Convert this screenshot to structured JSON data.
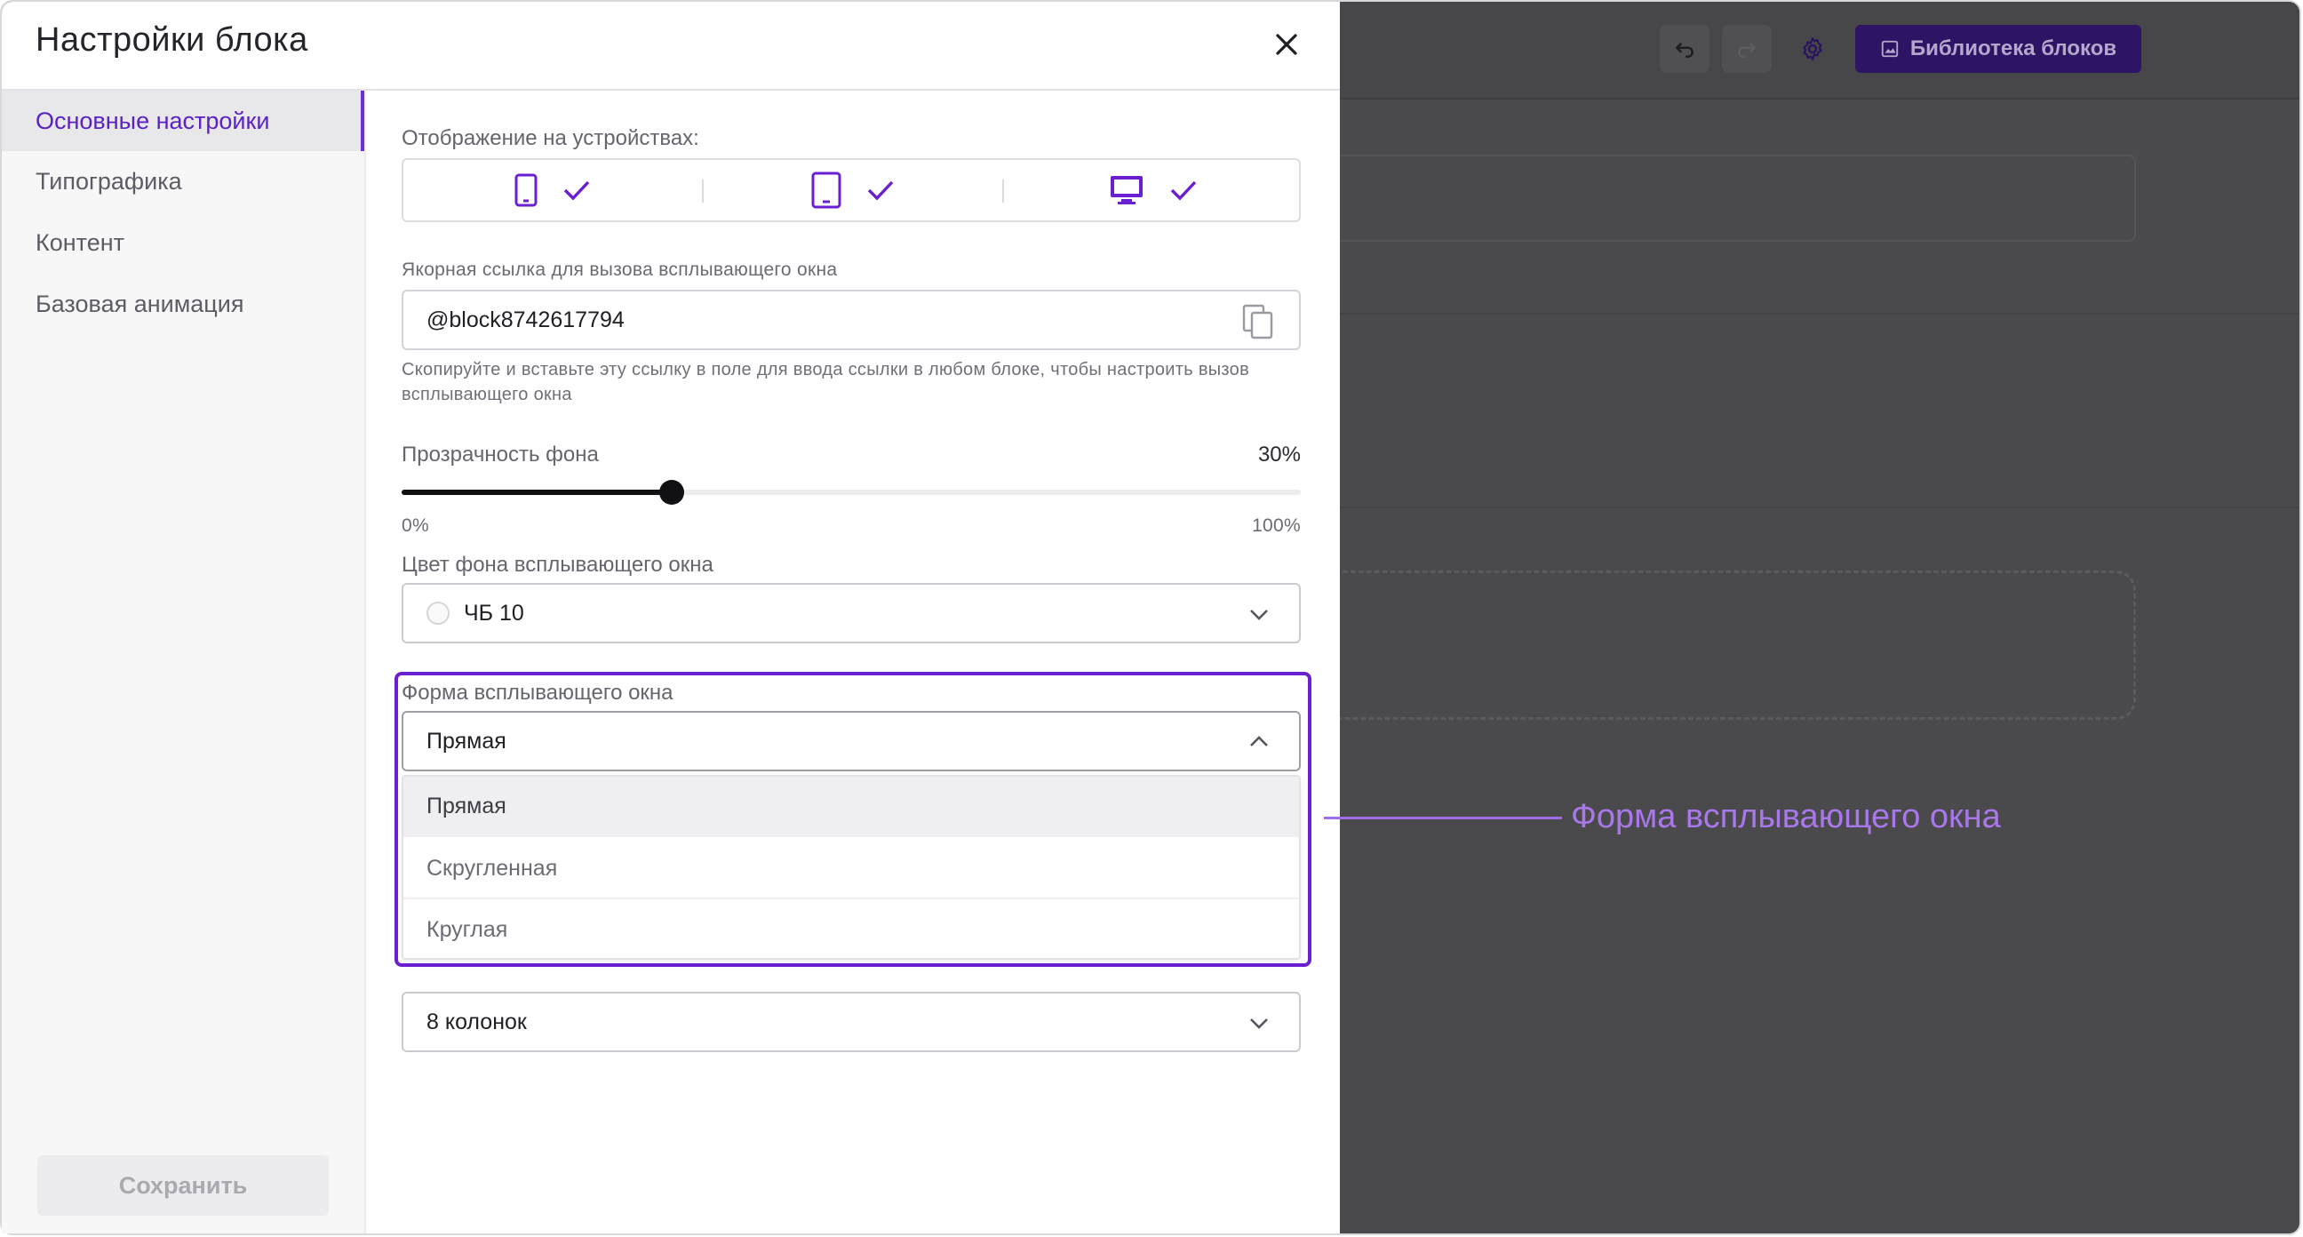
{
  "colors": {
    "accent": "#6a2fd6",
    "highlight_border": "#6a1fd1",
    "annotation": "#a877e9",
    "overlay": "#4a4a4d",
    "library_button_bg": "#2d1464"
  },
  "editor": {
    "toolbar": {
      "undo_icon": "undo-icon",
      "redo_icon": "redo-icon",
      "settings_icon": "gear-icon",
      "library_button_label": "Библиотека блоков",
      "library_button_icon": "image-icon"
    }
  },
  "modal": {
    "title": "Настройки блока",
    "close_icon": "close-icon",
    "sidebar": {
      "items": [
        {
          "label": "Основные настройки",
          "active": true
        },
        {
          "label": "Типографика",
          "active": false
        },
        {
          "label": "Контент",
          "active": false
        },
        {
          "label": "Базовая анимация",
          "active": false
        }
      ],
      "save_label": "Сохранить"
    },
    "devices": {
      "label": "Отображение на устройствах:",
      "items": [
        {
          "device": "mobile",
          "icon": "mobile-icon",
          "checked": true
        },
        {
          "device": "tablet",
          "icon": "tablet-icon",
          "checked": true
        },
        {
          "device": "desktop",
          "icon": "desktop-icon",
          "checked": true
        }
      ]
    },
    "anchor": {
      "label": "Якорная ссылка для вызова всплывающего окна",
      "value": "@block8742617794",
      "hint": "Скопируйте и вставьте эту ссылку в поле для ввода ссылки в любом блоке, чтобы настроить вызов всплывающего окна"
    },
    "opacity": {
      "label": "Прозрачность фона",
      "value_label": "30%",
      "value": 0.3,
      "min_label": "0%",
      "max_label": "100%"
    },
    "bg_color": {
      "label": "Цвет фона всплывающего окна",
      "value": "ЧБ 10"
    },
    "shape": {
      "label": "Форма всплывающего окна",
      "value": "Прямая",
      "options": [
        "Прямая",
        "Скругленная",
        "Круглая"
      ],
      "selected_index": 0
    },
    "columns": {
      "value": "8 колонок"
    }
  },
  "annotation": {
    "text": "Форма всплывающего окна"
  }
}
